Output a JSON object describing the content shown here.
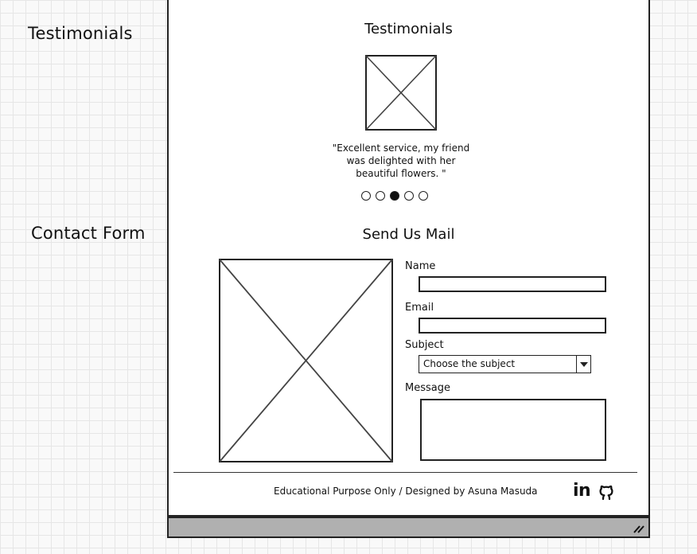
{
  "annotations": {
    "testimonials": "Testimonials",
    "contact_form": "Contact Form"
  },
  "testimonials": {
    "title": "Testimonials",
    "photo_icon": "image-placeholder-icon",
    "quote": "\"Excellent service, my friend was delighted with her beautiful flowers. \"",
    "dots_count": 5,
    "active_dot": 3
  },
  "contact": {
    "title": "Send Us Mail",
    "image_icon": "image-placeholder-icon",
    "name_label": "Name",
    "name_value": "",
    "email_label": "Email",
    "email_value": "",
    "subject_label": "Subject",
    "subject_selected": "Choose the subject",
    "message_label": "Message",
    "message_value": ""
  },
  "footer": {
    "text": "Educational Purpose Only / Designed by Asuna Masuda",
    "linkedin_icon_text": "in",
    "github_icon": "github-icon"
  },
  "colors": {
    "ink": "#222222",
    "statusbar": "#b0b0b0",
    "grid_line": "#e6e6e6",
    "background": "#f9f9f9"
  }
}
